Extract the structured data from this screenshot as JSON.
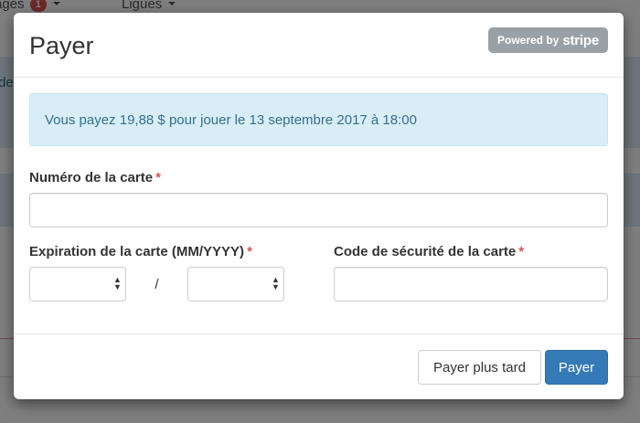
{
  "background": {
    "nav": {
      "item1_label": "ages",
      "item1_badge": "1",
      "item2_label": "Ligues"
    },
    "side_text": "de"
  },
  "modal": {
    "title": "Payer",
    "stripe_badge": {
      "prefix": "Powered by",
      "brand": "stripe"
    },
    "alert_text": "Vous payez 19,88 $ pour jouer le 13 septembre 2017 à 18:00",
    "card_number": {
      "label": "Numéro de la carte",
      "required_mark": "*",
      "value": ""
    },
    "expiry": {
      "label": "Expiration de la carte (MM/YYYY)",
      "required_mark": "*",
      "month_value": "",
      "year_value": "",
      "separator": "/"
    },
    "security_code": {
      "label": "Code de sécurité de la carte",
      "required_mark": "*",
      "value": ""
    },
    "buttons": {
      "later": "Payer plus tard",
      "pay": "Payer"
    }
  },
  "colors": {
    "primary": "#337ab7",
    "alert_bg": "#d9edf7",
    "alert_text": "#31708f",
    "required": "#d9534f",
    "stripe_badge": "#9aa1a6"
  }
}
